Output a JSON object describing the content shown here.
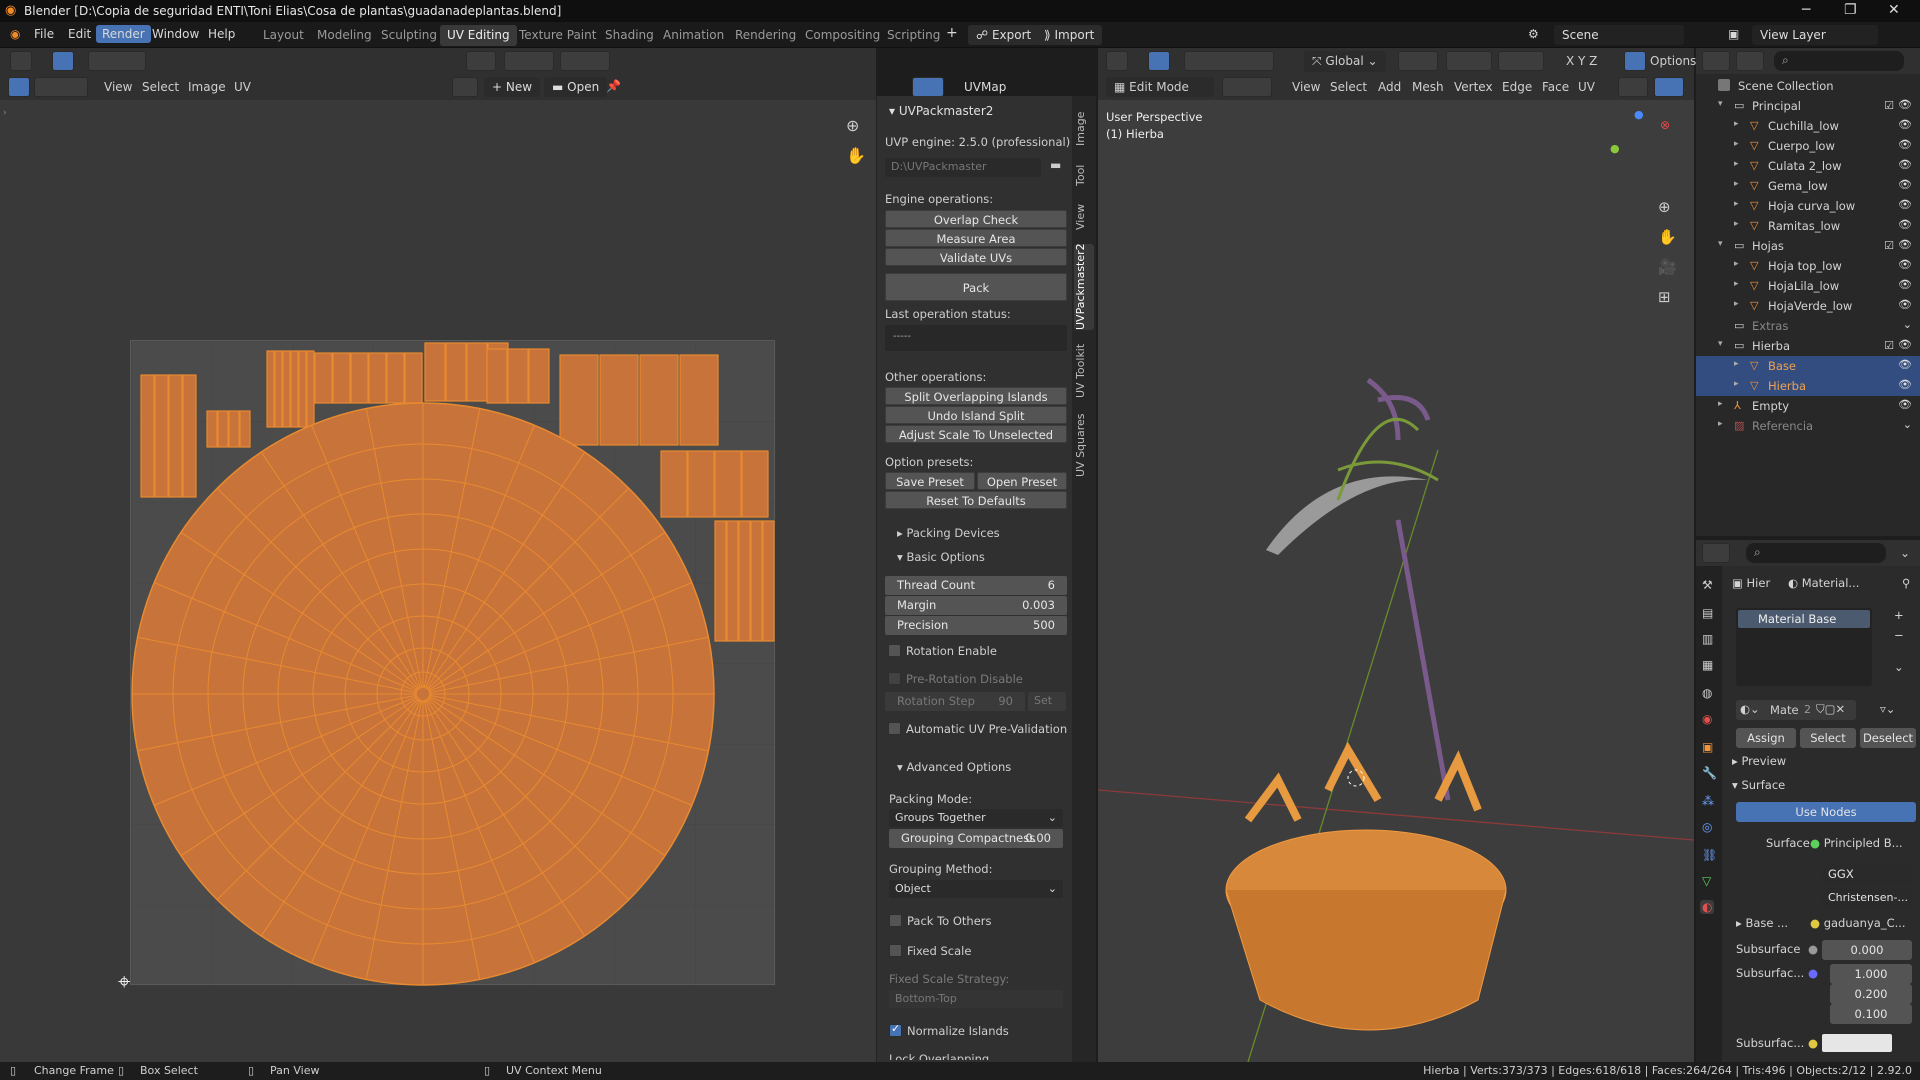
{
  "window": {
    "title": "Blender [D:\\Copia de seguridad ENTI\\Toni Elias\\Cosa de plantas\\guadanadeplantas.blend]"
  },
  "menu": {
    "file": "File",
    "edit": "Edit",
    "render": "Render",
    "window": "Window",
    "help": "Help"
  },
  "workspaces": [
    "Layout",
    "Modeling",
    "Sculpting",
    "UV Editing",
    "Texture Paint",
    "Shading",
    "Animation",
    "Rendering",
    "Compositing",
    "Scripting"
  ],
  "addons": {
    "export": "Export",
    "import": "Import"
  },
  "scene": {
    "name": "Scene",
    "view_layer": "View Layer"
  },
  "uv_editor": {
    "menus": [
      "View",
      "Select",
      "Image",
      "UV"
    ],
    "new": "New",
    "open": "Open",
    "uvmap": "UVMap"
  },
  "npanel": {
    "title": "UVPackmaster2",
    "engine": "UVP engine: 2.5.0 (professional)",
    "path_placeholder": "D:\\UVPackmaster",
    "engine_ops": "Engine operations:",
    "overlap": "Overlap Check",
    "measure": "Measure Area",
    "validate": "Validate UVs",
    "pack": "Pack",
    "last_status": "Last operation status:",
    "status_value": "-----",
    "other_ops": "Other operations:",
    "split": "Split Overlapping Islands",
    "undo_split": "Undo Island Split",
    "adjust": "Adjust Scale To Unselected",
    "presets": "Option presets:",
    "save_preset": "Save Preset",
    "open_preset": "Open Preset",
    "reset": "Reset To Defaults",
    "packing_devices": "Packing Devices",
    "basic": "Basic Options",
    "thread_label": "Thread Count",
    "thread_val": "6",
    "margin_label": "Margin",
    "margin_val": "0.003",
    "precision_label": "Precision",
    "precision_val": "500",
    "rotation_enable": "Rotation Enable",
    "prerot_disable": "Pre-Rotation Disable",
    "rot_step_label": "Rotation Step",
    "rot_step_val": "90",
    "set": "Set",
    "auto_prevalid": "Automatic UV Pre-Validation",
    "advanced": "Advanced Options",
    "packing_mode": "Packing Mode:",
    "packing_mode_val": "Groups Together",
    "grouping_comp_label": "Grouping Compactness",
    "grouping_comp_val": "0.00",
    "grouping_method": "Grouping Method:",
    "grouping_method_val": "Object",
    "pack_to_others": "Pack To Others",
    "fixed_scale": "Fixed Scale",
    "fixed_scale_strategy": "Fixed Scale Strategy:",
    "fixed_scale_strategy_val": "Bottom-Top",
    "normalize": "Normalize Islands",
    "lock_overlapping": "Lock Overlapping"
  },
  "side_tabs": [
    "Image",
    "Tool",
    "View",
    "UVPackmaster2",
    "UV Toolkit",
    "UV Squares"
  ],
  "viewport": {
    "mode": "Edit Mode",
    "menus": [
      "View",
      "Select",
      "Add",
      "Mesh",
      "Vertex",
      "Edge",
      "Face",
      "UV"
    ],
    "transform": "Global",
    "options": "Options",
    "info1": "User Perspective",
    "info2": "(1) Hierba"
  },
  "outliner": {
    "root": "Scene Collection",
    "rows": [
      {
        "name": "Principal",
        "kind": "collection",
        "level": 1,
        "open": true
      },
      {
        "name": "Cuchilla_low",
        "kind": "mesh",
        "level": 2
      },
      {
        "name": "Cuerpo_low",
        "kind": "mesh",
        "level": 2
      },
      {
        "name": "Culata 2_low",
        "kind": "mesh",
        "level": 2
      },
      {
        "name": "Gema_low",
        "kind": "mesh",
        "level": 2
      },
      {
        "name": "Hoja curva_low",
        "kind": "mesh",
        "level": 2
      },
      {
        "name": "Ramitas_low",
        "kind": "mesh",
        "level": 2
      },
      {
        "name": "Hojas",
        "kind": "collection",
        "level": 1,
        "open": true
      },
      {
        "name": "Hoja top_low",
        "kind": "mesh",
        "level": 2
      },
      {
        "name": "HojaLila_low",
        "kind": "mesh",
        "level": 2
      },
      {
        "name": "HojaVerde_low",
        "kind": "mesh",
        "level": 2
      },
      {
        "name": "Extras",
        "kind": "collection",
        "level": 1,
        "dim": true
      },
      {
        "name": "Hierba",
        "kind": "collection",
        "level": 1,
        "open": true
      },
      {
        "name": "Base",
        "kind": "mesh",
        "level": 2,
        "selected": true,
        "accent": true
      },
      {
        "name": "Hierba",
        "kind": "mesh",
        "level": 2,
        "selected": true,
        "accent": true
      },
      {
        "name": "Empty",
        "kind": "empty",
        "level": 1
      },
      {
        "name": "Referencia",
        "kind": "image",
        "level": 1,
        "dim": true
      }
    ]
  },
  "properties": {
    "tab1": "Hier",
    "tab2": "Material...",
    "material_slot": "Material Base",
    "mat_name": "Mate",
    "mat_users": "2",
    "assign": "Assign",
    "select": "Select",
    "deselect": "Deselect",
    "preview": "Preview",
    "surface_section": "Surface",
    "use_nodes": "Use Nodes",
    "surface_label": "Surface",
    "surface_val": "Principled B...",
    "dist": "GGX",
    "sss_method": "Christensen-...",
    "base_label": "Base ...",
    "base_val": "gaduanya_C...",
    "subsurface_label": "Subsurface",
    "subsurface_val": "0.000",
    "subsurf_radius_label": "Subsurfac...",
    "radius": [
      "1.000",
      "0.200",
      "0.100"
    ],
    "subsurf_color_label": "Subsurfac..."
  },
  "statusbar": {
    "change_frame": "Change Frame",
    "box_select": "Box Select",
    "pan_view": "Pan View",
    "context_menu": "UV Context Menu",
    "stats": "Hierba | Verts:373/373 | Edges:618/618 | Faces:264/264 | Tris:496 | Objects:2/12 | 2.92.0"
  },
  "colors": {
    "accent": "#4772b3",
    "uv": "#e07a2e",
    "selection": "#f0943c"
  }
}
